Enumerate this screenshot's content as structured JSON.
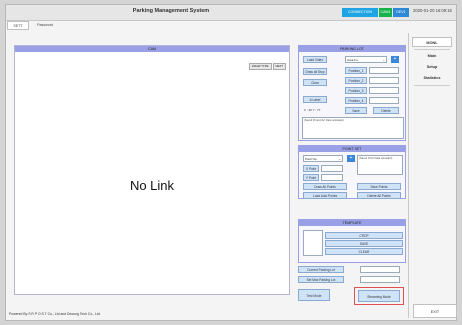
{
  "window": {
    "title": "Parking Management System"
  },
  "status": {
    "connection": "CONNECTION",
    "cam": "CAM1",
    "device": "DEV1"
  },
  "datetime": "2020-01-20 16:09:16",
  "tabs": [
    "SETT",
    "Password"
  ],
  "cam_panel": {
    "title": "CAM",
    "buttons": [
      "DRAW TYPE",
      "NEXT"
    ],
    "message": "No Link"
  },
  "parking_lot": {
    "title": "PARKING LOT",
    "load_video": "Load Video",
    "area_label": "Area Fn.",
    "draw_all_stop": "Draw all Stop",
    "clear": "Clear",
    "position_1": "Position_1",
    "position_2": "Position_2",
    "position_3": "Position_3",
    "position_4": "Position_4",
    "a_label": "A Label",
    "coord": "X : 30  Y : 77",
    "save": "Save",
    "delete": "Delete",
    "note": "(Saved Project/Arr Data uploaded)"
  },
  "point_set": {
    "title": "POINT SET",
    "point_no": "Point No.",
    "note": "(Saved Point Data uploaded)",
    "x_point": "X Point",
    "y_point": "Y Point",
    "draw_all_points": "Draw All Points",
    "save_points": "Save Points",
    "load_auto_points": "Load Auto Points",
    "delete_all_points": "Delete All Points"
  },
  "template": {
    "title": "TEMPLATE",
    "crop": "CROP",
    "save": "SAVE",
    "clear": "CLEAR"
  },
  "lot_fields": {
    "current_label": "Current Parking Lot",
    "set_max_label": "Set Max Parking Lot"
  },
  "modes": {
    "test": "Test Mode",
    "streaming": "Streaming Mode"
  },
  "nav": {
    "items": [
      "MONL",
      "Main",
      "Setup",
      "Statistics"
    ],
    "exit": "EXIT"
  },
  "footer": "Powered By S R P O S T Co., Ltd and Deoung Tech Co., Ltd",
  "colors": {
    "accent_blue": "#9aa0e6",
    "button_fill": "#cfe3f6",
    "highlight_red": "#e05050"
  }
}
